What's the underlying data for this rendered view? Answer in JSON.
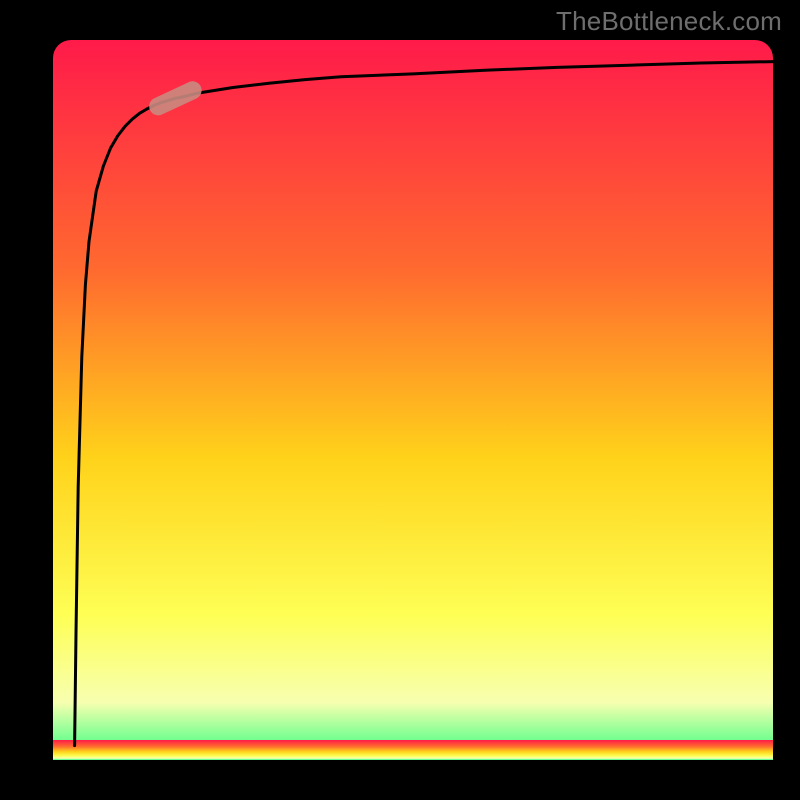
{
  "watermark": "TheBottleneck.com",
  "colors": {
    "background": "#000000",
    "frame": "#000000",
    "gradient_top": "#ff1a4a",
    "gradient_mid_upper": "#ff6a2f",
    "gradient_mid": "#ffd21a",
    "gradient_mid_lower": "#feff55",
    "gradient_bottom_glow": "#f7ffb0",
    "gradient_bottom": "#2bff7e",
    "curve": "#000000",
    "marker_fill": "#c98a7f",
    "marker_stroke": "#c98a7f"
  },
  "chart_data": {
    "type": "line",
    "title": "",
    "xlabel": "",
    "ylabel": "",
    "xlim": [
      0,
      100
    ],
    "ylim": [
      0,
      100
    ],
    "x": [
      3.0,
      3.2,
      3.5,
      4.0,
      4.5,
      5.0,
      6.0,
      7.0,
      8.0,
      9.0,
      10.0,
      11.0,
      12.0,
      13.0,
      14.0,
      15.0,
      16.0,
      17.0,
      18.0,
      20.0,
      25.0,
      30.0,
      35.0,
      40.0,
      50.0,
      60.0,
      70.0,
      80.0,
      90.0,
      100.0
    ],
    "y": [
      2.0,
      18.0,
      38.0,
      56.0,
      66.0,
      72.0,
      79.0,
      82.5,
      85.0,
      86.7,
      88.0,
      89.0,
      89.8,
      90.4,
      90.9,
      91.3,
      91.6,
      91.9,
      92.1,
      92.6,
      93.4,
      94.0,
      94.5,
      94.9,
      95.3,
      95.8,
      96.2,
      96.5,
      96.8,
      97.0
    ],
    "marker": {
      "x_center": 17.0,
      "y_center": 91.9,
      "angle_deg": 25
    },
    "axis_ticks_visible": false,
    "grid": false
  }
}
